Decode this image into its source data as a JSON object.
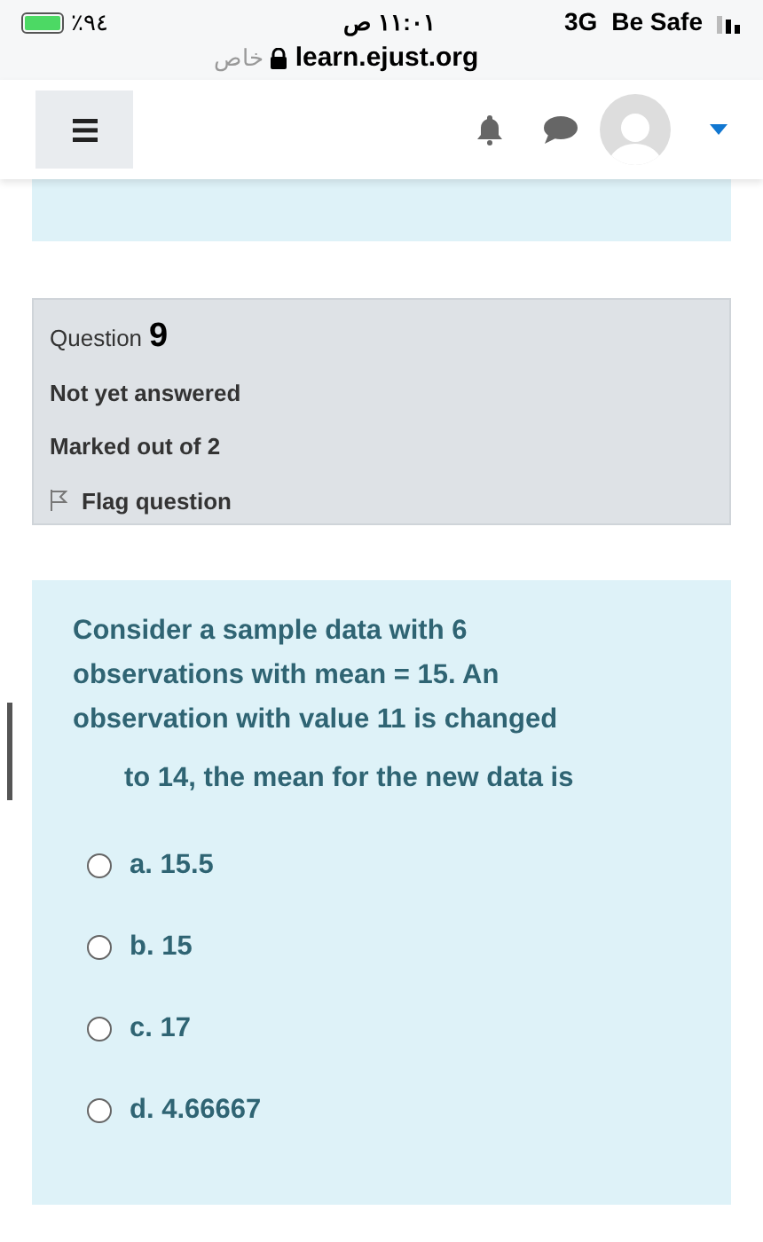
{
  "status_bar": {
    "battery": "٪٩٤",
    "time": "١١:٠١ ص",
    "network": "3G",
    "carrier": "Be Safe",
    "url": "learn.ejust.org",
    "private_label": "خاص"
  },
  "question_info": {
    "label": "Question",
    "number": "9",
    "state": "Not yet answered",
    "mark": "Marked out of 2",
    "flag": {
      "label": "Flag question",
      "flagged": false
    }
  },
  "question": {
    "paragraphs": [
      "Consider a sample data with 6 observations with mean = 15. An observation with value 11 is changed",
      "to 14, the mean for the new data is"
    ],
    "options": [
      {
        "label": "a. 15.5",
        "selected": false
      },
      {
        "label": "b. 15",
        "selected": false
      },
      {
        "label": "c. 17",
        "selected": false
      },
      {
        "label": "d. 4.66667",
        "selected": false
      }
    ]
  }
}
